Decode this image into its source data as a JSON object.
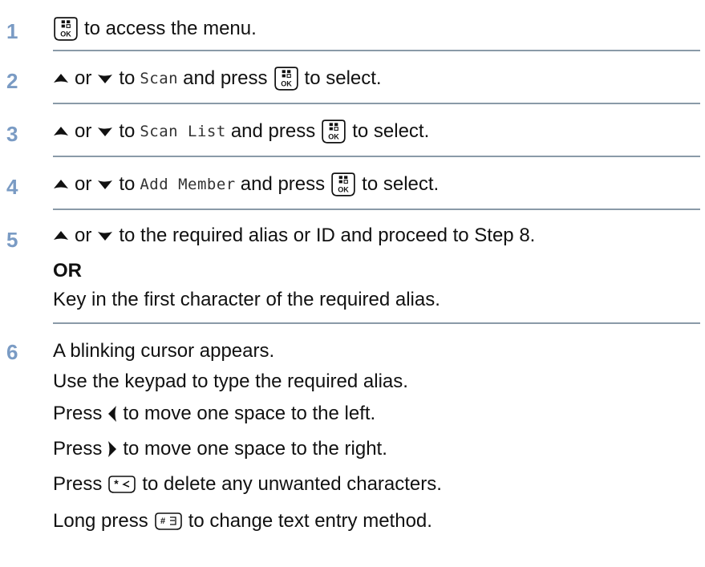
{
  "steps": [
    {
      "number": "1",
      "text": "to access the menu."
    },
    {
      "number": "2",
      "or": "or",
      "to": "to",
      "menu": "Scan",
      "press": "and press",
      "select": "to select."
    },
    {
      "number": "3",
      "or": "or",
      "to": "to",
      "menu": "Scan List",
      "press": "and press",
      "select": "to select."
    },
    {
      "number": "4",
      "or": "or",
      "to": "to",
      "menu": "Add Member",
      "press": "and press",
      "select": "to select."
    },
    {
      "number": "5",
      "or": "or",
      "text": "to the required alias or ID and proceed to Step 8.",
      "alt": "OR",
      "alt_text": "Key in the first character of the required alias."
    },
    {
      "number": "6",
      "line1": "A blinking cursor appears.",
      "line2": "Use the keypad to type the required alias.",
      "press": "Press",
      "left_text": "to move one space to the left.",
      "right_text": "to move one space to the right.",
      "delete_text": "to delete any unwanted characters.",
      "long_press": "Long press",
      "method_text": "to change text entry method."
    }
  ],
  "icons": {
    "menu_ok_button": "menu-ok-button-icon",
    "up_arrow": "up-arrow-icon",
    "down_arrow": "down-arrow-icon",
    "left_arrow": "left-arrow-icon",
    "right_arrow": "right-arrow-icon",
    "star_button": "star-delete-button-icon",
    "hash_button": "hash-button-icon"
  },
  "colors": {
    "step_number": "#7a9bc4",
    "divider": "#8a9aa8",
    "text": "#111111"
  }
}
